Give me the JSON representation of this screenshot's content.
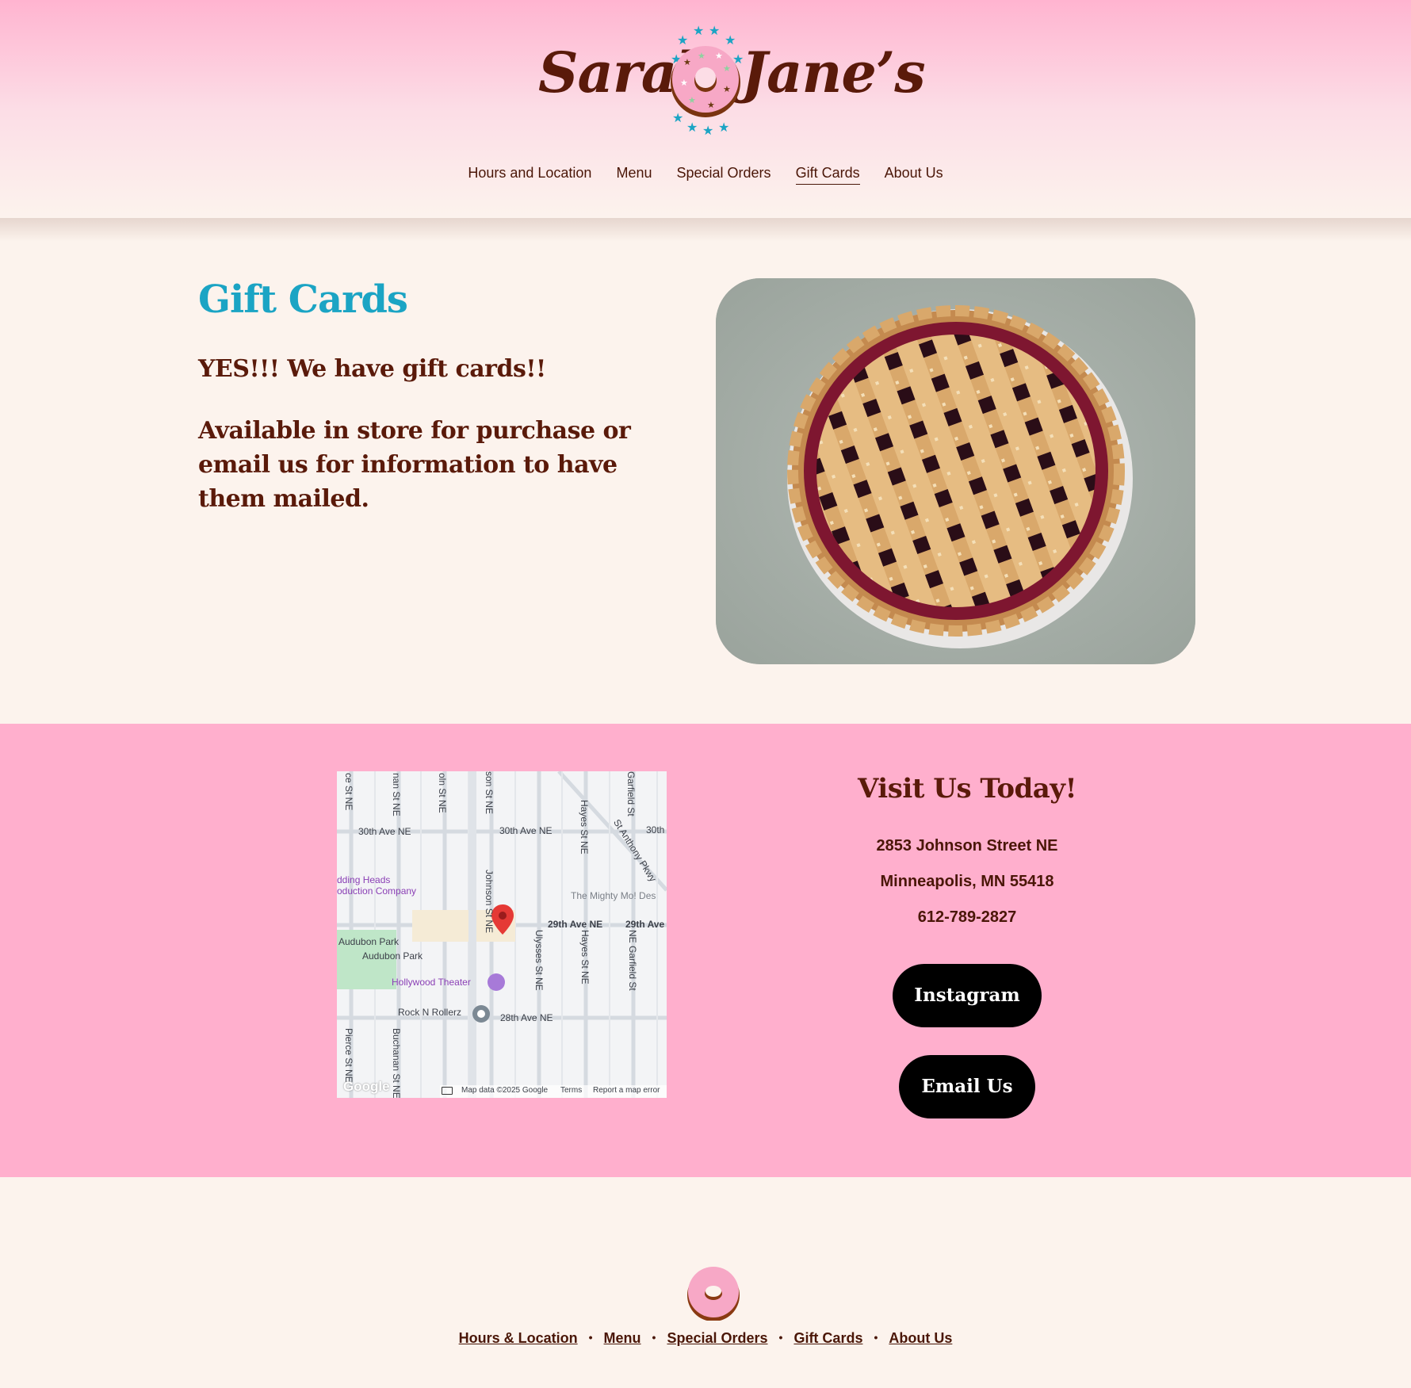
{
  "brand": {
    "name_left": "Sarah",
    "name_right": "Jane’s"
  },
  "nav": {
    "items": [
      {
        "label": "Hours and Location"
      },
      {
        "label": "Menu"
      },
      {
        "label": "Special Orders"
      },
      {
        "label": "Gift Cards",
        "active": true
      },
      {
        "label": "About Us"
      }
    ]
  },
  "main": {
    "title": "Gift Cards",
    "subtitle": "YES!!! We have gift cards!!",
    "body": "Available in store for purchase or email us for information to have them mailed."
  },
  "visit": {
    "title": "Visit Us Today!",
    "address_line1": "2853 Johnson Street NE",
    "address_line2": "Minneapolis, MN 55418",
    "phone": "612-789-2827",
    "instagram_label": "Instagram",
    "email_label": "Email Us"
  },
  "map": {
    "labels": {
      "s1": "ce St NE",
      "s2": "nan St NE",
      "s3": "oln St NE",
      "s4": "son St NE",
      "s5": "Hayes St NE",
      "s6": "Garfield St",
      "a30l": "30th Ave NE",
      "a30r": "30th Ave NE",
      "a30rr": "30th",
      "stanthony": "St Anthony Pkwy",
      "budding1": "dding Heads",
      "budding2": "oduction Company",
      "mighty": "The Mighty Mo! Des",
      "johnson": "Johnson St NE",
      "a29": "29th Ave NE",
      "a29r": "29th Ave",
      "audubon1": "Audubon Park",
      "audubon2": "Audubon Park",
      "ulysses": "Ulysses St NE",
      "hayes2": "Hayes St NE",
      "garfield2": "NE Garfield St",
      "hollywood": "Hollywood Theater",
      "rock": "Rock N Rollerz",
      "a28": "28th Ave NE",
      "pierce": "Pierce St NE",
      "buchanan": "Buchanan St NE",
      "google": "Google",
      "mapdata": "Map data ©2025 Google",
      "terms": "Terms",
      "report": "Report a map error"
    }
  },
  "footer": {
    "links": [
      {
        "label": "Hours & Location"
      },
      {
        "label": "Menu"
      },
      {
        "label": "Special Orders"
      },
      {
        "label": "Gift Cards"
      },
      {
        "label": "About Us"
      }
    ],
    "separator": "•"
  },
  "colors": {
    "pink": "#ffafcd",
    "cream": "#fcf3ed",
    "brown": "#5a1a0a",
    "teal": "#1ba4c4",
    "black": "#000000"
  },
  "icons": {
    "logo_donut": "donut-icon",
    "map_pin": "map-pin-icon",
    "footer_donut": "donut-icon"
  }
}
